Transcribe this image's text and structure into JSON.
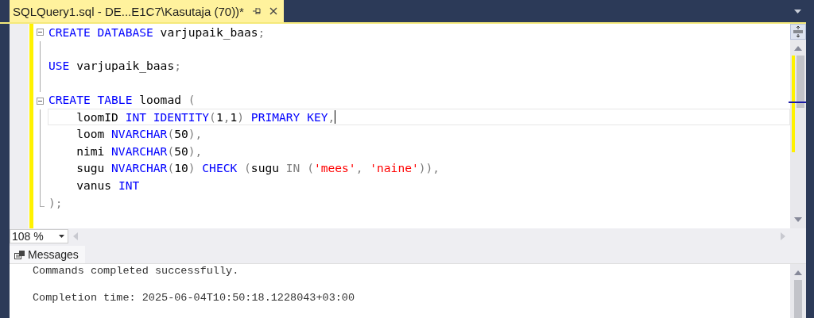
{
  "tab": {
    "title": "SQLQuery1.sql - DE...E1C7\\Kasutaja (70))*",
    "selected": true
  },
  "editor": {
    "lines": [
      {
        "kind": "collapse",
        "current": false,
        "tokens": [
          {
            "kind": "kw",
            "text": "CREATE DATABASE "
          },
          {
            "kind": "id",
            "text": "varjupaik_baas"
          },
          {
            "kind": "op",
            "text": ";"
          }
        ]
      },
      {
        "kind": "line",
        "current": false
      },
      {
        "kind": "line",
        "current": false,
        "tokens": [
          {
            "kind": "kw",
            "text": "USE "
          },
          {
            "kind": "id",
            "text": "varjupaik_baas"
          },
          {
            "kind": "op",
            "text": ";"
          }
        ]
      },
      {
        "kind": "line",
        "current": false
      },
      {
        "kind": "collapse",
        "current": false,
        "tokens": [
          {
            "kind": "kw",
            "text": "CREATE TABLE "
          },
          {
            "kind": "id",
            "text": "loomad "
          },
          {
            "kind": "op",
            "text": "("
          }
        ]
      },
      {
        "kind": "line",
        "current": true,
        "tokens": [
          {
            "kind": "id",
            "text": "    loomID "
          },
          {
            "kind": "kw",
            "text": "INT IDENTITY"
          },
          {
            "kind": "op",
            "text": "("
          },
          {
            "kind": "id",
            "text": "1"
          },
          {
            "kind": "op",
            "text": ","
          },
          {
            "kind": "id",
            "text": "1"
          },
          {
            "kind": "op",
            "text": ") "
          },
          {
            "kind": "kw",
            "text": "PRIMARY KEY"
          },
          {
            "kind": "op",
            "text": ","
          }
        ]
      },
      {
        "kind": "line",
        "current": false,
        "tokens": [
          {
            "kind": "id",
            "text": "    loom "
          },
          {
            "kind": "kw",
            "text": "NVARCHAR"
          },
          {
            "kind": "op",
            "text": "("
          },
          {
            "kind": "id",
            "text": "50"
          },
          {
            "kind": "op",
            "text": "),"
          }
        ]
      },
      {
        "kind": "line",
        "current": false,
        "tokens": [
          {
            "kind": "id",
            "text": "    nimi "
          },
          {
            "kind": "kw",
            "text": "NVARCHAR"
          },
          {
            "kind": "op",
            "text": "("
          },
          {
            "kind": "id",
            "text": "50"
          },
          {
            "kind": "op",
            "text": "),"
          }
        ]
      },
      {
        "kind": "line",
        "current": false,
        "tokens": [
          {
            "kind": "id",
            "text": "    sugu "
          },
          {
            "kind": "kw",
            "text": "NVARCHAR"
          },
          {
            "kind": "op",
            "text": "("
          },
          {
            "kind": "id",
            "text": "10"
          },
          {
            "kind": "op",
            "text": ") "
          },
          {
            "kind": "kw",
            "text": "CHECK "
          },
          {
            "kind": "op",
            "text": "("
          },
          {
            "kind": "id",
            "text": "sugu "
          },
          {
            "kind": "op",
            "text": "IN ("
          },
          {
            "kind": "str",
            "text": "'mees'"
          },
          {
            "kind": "op",
            "text": ", "
          },
          {
            "kind": "str",
            "text": "'naine'"
          },
          {
            "kind": "op",
            "text": ")),"
          }
        ]
      },
      {
        "kind": "line",
        "current": false,
        "tokens": [
          {
            "kind": "id",
            "text": "    vanus "
          },
          {
            "kind": "kw",
            "text": "INT"
          }
        ]
      },
      {
        "kind": "end",
        "current": false,
        "tokens": [
          {
            "kind": "op",
            "text": ");"
          }
        ]
      }
    ]
  },
  "zoom": {
    "value": "108 %"
  },
  "results": {
    "tab": "Messages",
    "messages": [
      "Commands completed successfully.",
      "Completion time: 2025-06-04T10:50:18.1228043+03:00"
    ]
  }
}
